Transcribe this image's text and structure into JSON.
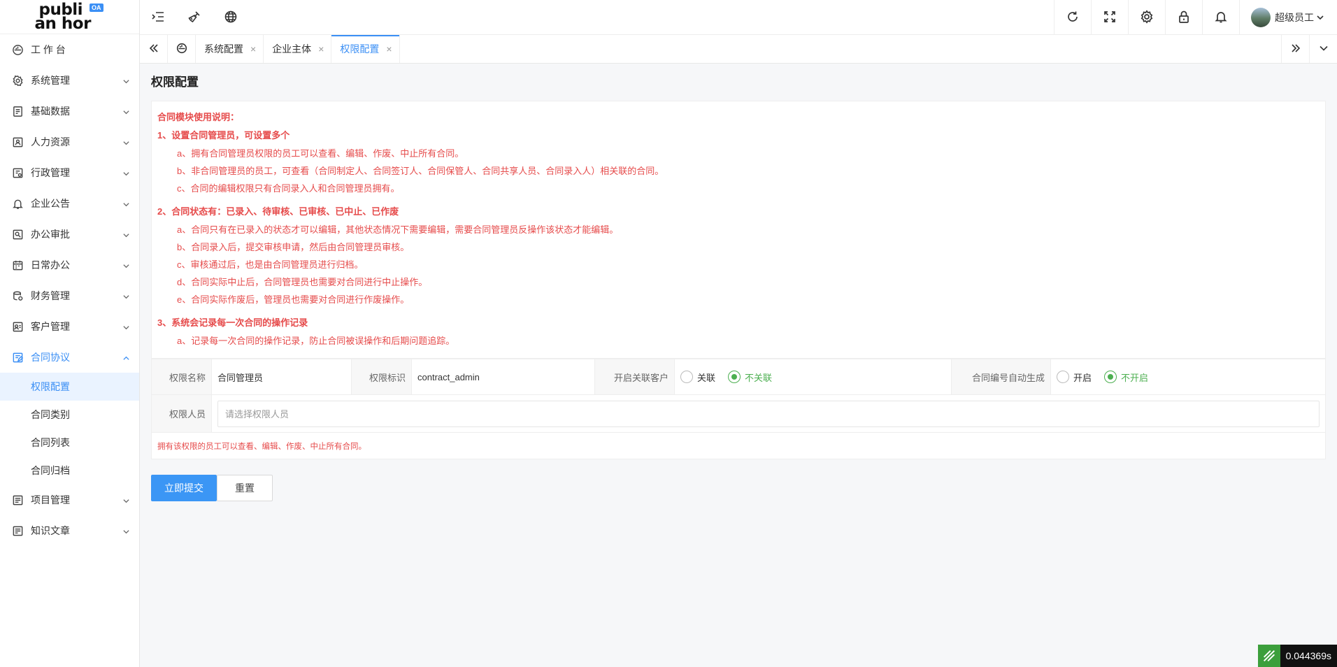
{
  "app": {
    "logo_line1": "publi",
    "logo_line2": "an hor",
    "logo_badge": "OA"
  },
  "sidebar": {
    "items": [
      {
        "label": "工 作 台",
        "icon": "dashboard-icon",
        "has_children": false
      },
      {
        "label": "系统管理",
        "icon": "gear-icon",
        "has_children": true
      },
      {
        "label": "基础数据",
        "icon": "database-icon",
        "has_children": true
      },
      {
        "label": "人力资源",
        "icon": "id-card-icon",
        "has_children": true
      },
      {
        "label": "行政管理",
        "icon": "admin-icon",
        "has_children": true
      },
      {
        "label": "企业公告",
        "icon": "bell-icon",
        "has_children": true
      },
      {
        "label": "办公审批",
        "icon": "approval-icon",
        "has_children": true
      },
      {
        "label": "日常办公",
        "icon": "calendar-icon",
        "has_children": true
      },
      {
        "label": "财务管理",
        "icon": "finance-icon",
        "has_children": true
      },
      {
        "label": "客户管理",
        "icon": "customer-icon",
        "has_children": true
      },
      {
        "label": "合同协议",
        "icon": "contract-icon",
        "has_children": true,
        "open": true
      },
      {
        "label": "项目管理",
        "icon": "project-icon",
        "has_children": true
      },
      {
        "label": "知识文章",
        "icon": "article-icon",
        "has_children": true
      }
    ],
    "contract_children": [
      "权限配置",
      "合同类别",
      "合同列表",
      "合同归档"
    ],
    "active_child": "权限配置"
  },
  "header": {
    "user_name": "超级员工"
  },
  "tabs": [
    {
      "label": "系统配置",
      "active": false
    },
    {
      "label": "企业主体",
      "active": false
    },
    {
      "label": "权限配置",
      "active": true
    }
  ],
  "tab_close_glyph": "×",
  "page": {
    "title": "权限配置",
    "notice": {
      "heading": "合同模块使用说明：",
      "sections": [
        {
          "title": "1、设置合同管理员，可设置多个",
          "lines": [
            "a、拥有合同管理员权限的员工可以查看、编辑、作废、中止所有合同。",
            "b、非合同管理员的员工，可查看（合同制定人、合同签订人、合同保管人、合同共享人员、合同录入人）相关联的合同。",
            "c、合同的编辑权限只有合同录入人和合同管理员拥有。"
          ]
        },
        {
          "title": "2、合同状态有：已录入、待审核、已审核、已中止、已作废",
          "lines": [
            "a、合同只有在已录入的状态才可以编辑，其他状态情况下需要编辑，需要合同管理员反操作该状态才能编辑。",
            "b、合同录入后，提交审核申请，然后由合同管理员审核。",
            "c、审核通过后，也是由合同管理员进行归档。",
            "d、合同实际中止后，合同管理员也需要对合同进行中止操作。",
            "e、合同实际作废后，管理员也需要对合同进行作废操作。"
          ]
        },
        {
          "title": "3、系统会记录每一次合同的操作记录",
          "lines": [
            "a、记录每一次合同的操作记录，防止合同被误操作和后期问题追踪。"
          ]
        }
      ]
    },
    "form": {
      "name_label": "权限名称",
      "name_value": "合同管理员",
      "key_label": "权限标识",
      "key_value": "contract_admin",
      "link_label": "开启关联客户",
      "link_options": [
        "关联",
        "不关联"
      ],
      "link_selected": "不关联",
      "autogen_label": "合同编号自动生成",
      "autogen_options": [
        "开启",
        "不开启"
      ],
      "autogen_selected": "不开启",
      "members_label": "权限人员",
      "members_placeholder": "请选择权限人员",
      "tip": "拥有该权限的员工可以查看、编辑、作废、中止所有合同。"
    },
    "actions": {
      "submit": "立即提交",
      "reset": "重置"
    }
  },
  "timer": {
    "value": "0.044369s"
  },
  "colors": {
    "accent": "#3b8ff5",
    "danger": "#e64b4b",
    "success": "#4caf50"
  }
}
